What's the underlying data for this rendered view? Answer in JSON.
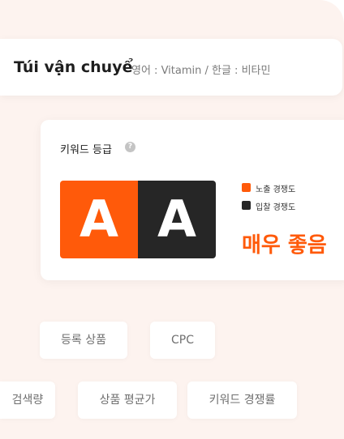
{
  "header": {
    "title": "Túi vận chuyể",
    "subtitle": "영어 : Vitamin / 한글 : 비타민"
  },
  "keyword_grade": {
    "label": "키워드 등급",
    "help": "?",
    "grade_exposure": "A",
    "grade_bid": "A",
    "legend": [
      {
        "label": "노출 경쟁도",
        "color": "#ff5a0a"
      },
      {
        "label": "입찰 경쟁도",
        "color": "#262626"
      }
    ],
    "status": "매우 좋음",
    "status_color": "#ff5a0a"
  },
  "chips": {
    "registered_products": "등록 상품",
    "cpc": "CPC",
    "search_volume": "검색량",
    "product_avg_price": "상품 평균가",
    "keyword_competition": "키워드 경쟁률"
  }
}
